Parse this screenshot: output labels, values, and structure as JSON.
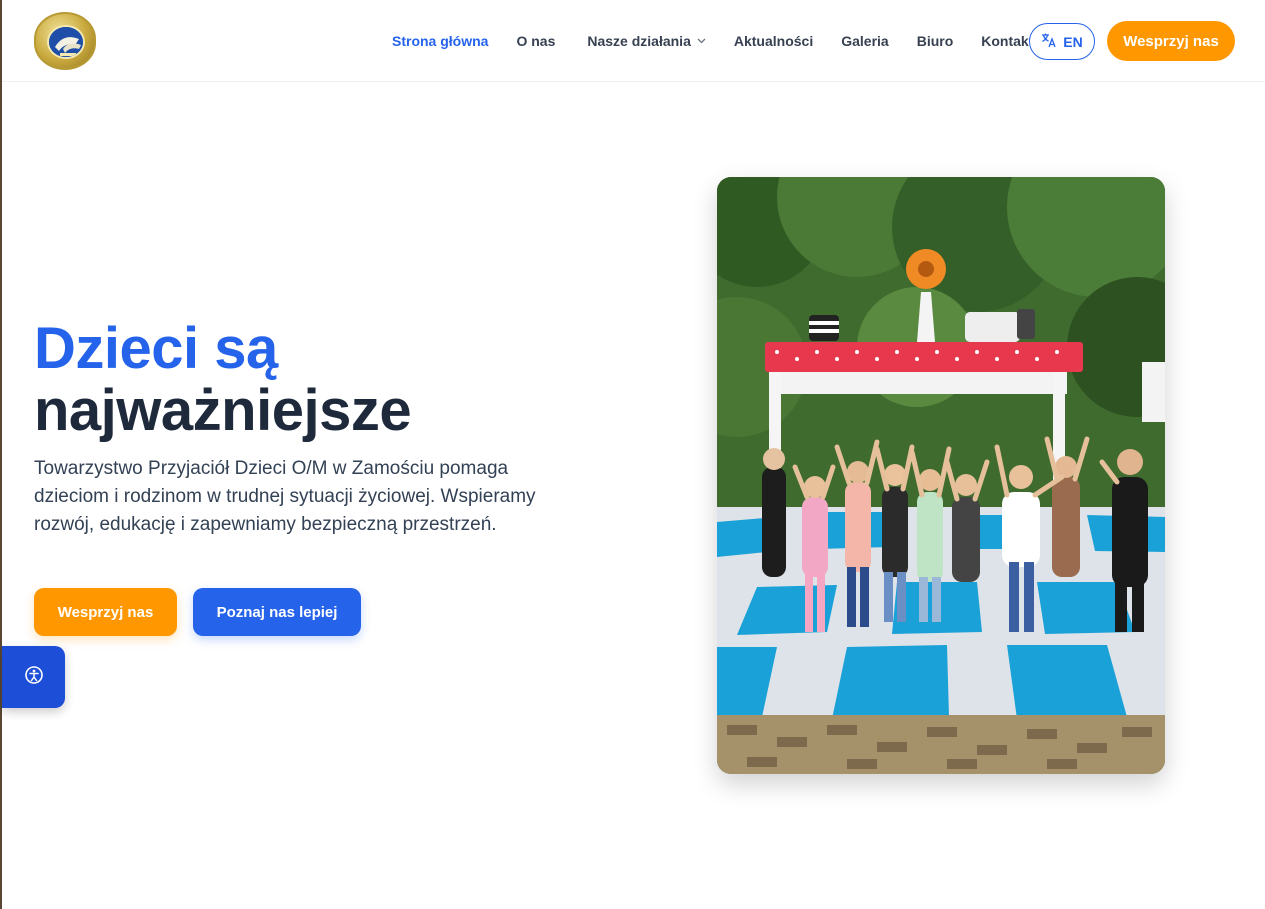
{
  "header": {
    "logo_alt": "Towarzystwo Przyjaciół Dzieci logo",
    "nav": [
      {
        "label": "Strona główna",
        "active": true
      },
      {
        "label": "O nas"
      },
      {
        "label": "Nasze działania",
        "dropdown": true
      },
      {
        "label": "Aktualności"
      },
      {
        "label": "Galeria"
      },
      {
        "label": "Biuro"
      },
      {
        "label": "Kontakt"
      }
    ],
    "lang_label": "EN",
    "support_label": "Wesprzyj nas"
  },
  "hero": {
    "title_line1": "Dzieci są",
    "title_line2": "najważniejsze",
    "description": "Towarzystwo Przyjaciół Dzieci O/M w Zamościu pomaga dzieciom i rodzinom w trudnej sytuacji życiowej. Wspieramy rozwój, edukację i zapewniamy bezpieczną przestrzeń.",
    "primary_button": "Wesprzyj nas",
    "secondary_button": "Poznaj nas lepiej"
  },
  "colors": {
    "accent_blue": "#2563eb",
    "accent_orange": "#ff9800",
    "heading_dark": "#1e293b"
  },
  "icons": {
    "translate": "translate-icon",
    "accessibility": "accessibility-icon",
    "dropdown": "chevron-down-icon"
  }
}
